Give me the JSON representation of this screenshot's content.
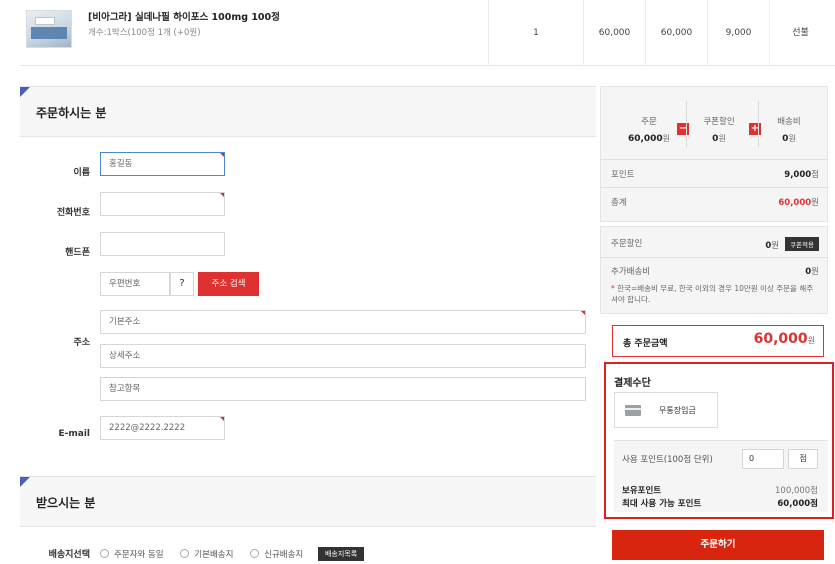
{
  "product": {
    "name": "[비아그라] 실데나필 하이포스 100mg 100정",
    "option": "개수:1박스(100정 1개 (+0원)",
    "quantity": "1",
    "price": "60,000",
    "sum": "60,000",
    "points": "9,000",
    "shipping": "선불"
  },
  "orderer": {
    "title": "주문하시는 분",
    "name_label": "이름",
    "name_value": "홍길동",
    "phone_label": "전화번호",
    "mobile_label": "핸드폰",
    "zip_placeholder": "우편번호",
    "help_icon": "?",
    "address_search_label": "주소 검색",
    "address_label": "주소",
    "addr1_placeholder": "기본주소",
    "addr2_placeholder": "상세주소",
    "addr3_placeholder": "참고항목",
    "email_label": "E-mail",
    "email_value": "2222@2222.2222"
  },
  "receiver": {
    "title": "받으시는 분",
    "ship_select_label": "배송지선택",
    "options": [
      "주문자와 동일",
      "기본배송지",
      "신규배송지"
    ],
    "ship_list_button": "배송지목록"
  },
  "summary": {
    "order_label": "주문",
    "order_value": "60,000",
    "coupon_label": "쿠폰할인",
    "coupon_value": "0",
    "shipping_label": "배송비",
    "shipping_value": "0",
    "won": "원",
    "minus": "−",
    "plus": "+",
    "point_label": "포인트",
    "point_value": "9,000",
    "point_unit": "점",
    "total_label": "총계",
    "total_value": "60,000",
    "order_discount_label": "주문할인",
    "order_discount_value": "0",
    "coupon_apply_button": "쿠폰적용",
    "extra_ship_label": "추가배송비",
    "extra_ship_value": "0",
    "note_star": "*",
    "note_text": "한국=배송비 무료, 한국 이외의 경우 10만원 이상 주문을 해주셔야 합니다."
  },
  "grand_total": {
    "label": "총 주문금액",
    "value": "60,000",
    "unit": "원"
  },
  "payment": {
    "title": "결제수단",
    "method": "무통장입금",
    "use_points_label": "사용 포인트(100점 단위)",
    "use_points_value": "0",
    "use_points_unit": "점",
    "owned_points_label": "보유포인트",
    "owned_points_value": "100,000점",
    "max_points_label": "최대 사용 가능 포인트",
    "max_points_value": "60,000점"
  },
  "order_button": "주문하기",
  "colors": {
    "accent_red": "#e03131",
    "highlight_border": "#e01e1e",
    "order_button": "#d8250f",
    "section_corner": "#4b5fb0"
  }
}
